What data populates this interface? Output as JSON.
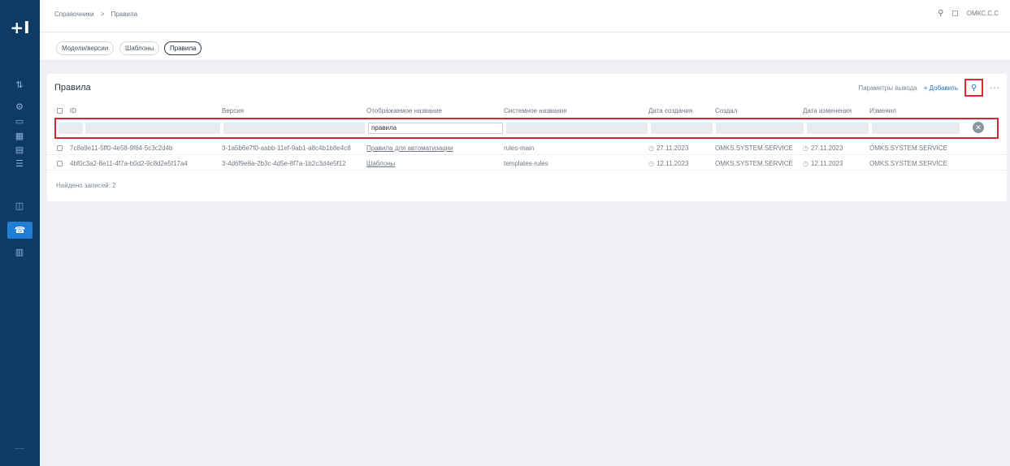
{
  "sidebar": {
    "logo": "+I",
    "items": [
      {
        "icon": "chart-icon",
        "glyph": "⇅"
      },
      {
        "icon": "gear-icon",
        "glyph": "⚙"
      },
      {
        "icon": "clipboard-icon",
        "glyph": "▭"
      },
      {
        "icon": "grid-icon",
        "glyph": "▦"
      },
      {
        "icon": "card-icon",
        "glyph": "▤"
      },
      {
        "icon": "list-icon",
        "glyph": "☰"
      },
      {
        "icon": "database-icon",
        "glyph": "◫"
      },
      {
        "icon": "phone-icon",
        "glyph": "☎",
        "active": true
      },
      {
        "icon": "table-icon",
        "glyph": "▥"
      }
    ]
  },
  "header": {
    "breadcrumb": [
      "Справочники",
      ">",
      "Правила"
    ],
    "search_glyph": "⚲",
    "notify_glyph": "◻",
    "user": "ОМКС.С.С"
  },
  "tabs": [
    {
      "label": "Модели/версии",
      "active": false
    },
    {
      "label": "Шаблоны",
      "active": false
    },
    {
      "label": "Правила",
      "active": true
    }
  ],
  "card": {
    "title": "Правила",
    "actions": {
      "settings_label": "Параметры вывода",
      "add_label": "+ Добавить",
      "filter_glyph": "⚲",
      "more_glyph": "···"
    }
  },
  "table": {
    "columns": [
      "ID",
      "Версия",
      "Отображаемое название",
      "Системное название",
      "Дата создания",
      "Создал",
      "Дата изменения",
      "Изменил"
    ],
    "filter": {
      "display_name_value": "правила",
      "clear_glyph": "✕"
    },
    "rows": [
      {
        "id": "7c8a9e11-5ff0-4e58-9f64-5c3c2d4b",
        "version": "3-1a5b6e7f0-aabb-11ef-9ab1-a8c4b1b8e4c8",
        "display_name": "Правила для автоматизации",
        "system_name": "rules-main",
        "created": "27.11.2023",
        "created_by": "OMKS.SYSTEM.SERVICE",
        "modified": "27.11.2023",
        "modified_by": "OMKS.SYSTEM.SERVICE"
      },
      {
        "id": "4bf0c3a2-8e11-4f7a-b0d2-9c8d2e5f17a4",
        "version": "3-4d6f9e8a-2b3c-4d5e-8f7a-1b2c3d4e5f12",
        "display_name": "Шаблоны",
        "system_name": "templates-rules",
        "created": "12.11.2023",
        "created_by": "OMKS.SYSTEM.SERVICE",
        "modified": "12.11.2023",
        "modified_by": "OMKS.SYSTEM.SERVICE"
      }
    ],
    "footer": "Найдено записей: 2"
  }
}
